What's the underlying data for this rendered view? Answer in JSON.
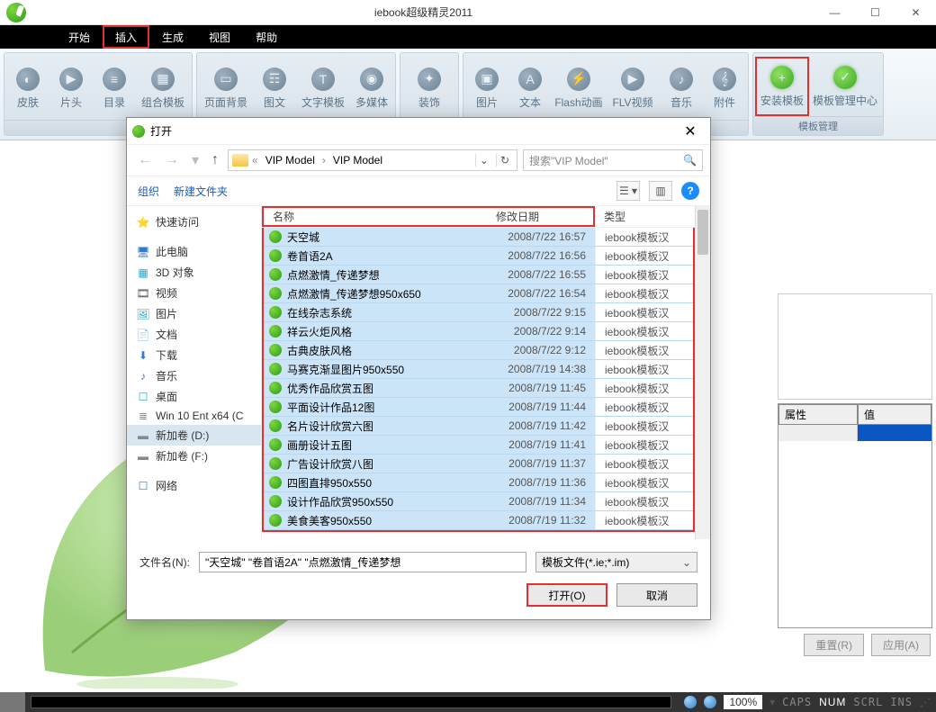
{
  "window": {
    "title": "iebook超级精灵2011",
    "minimize": "—",
    "maximize": "☐",
    "close": "✕"
  },
  "menu": {
    "start": "开始",
    "insert": "插入",
    "generate": "生成",
    "view": "视图",
    "help": "帮助"
  },
  "ribbon": {
    "g1": {
      "skin": "皮肤",
      "title": "片头",
      "toc": "目录",
      "combo": "组合模板"
    },
    "g2": {
      "pagebg": "页面背景",
      "imgtxt": "图文",
      "txttpl": "文字模板",
      "media": "多媒体"
    },
    "g3": {
      "decor": "装饰"
    },
    "g4": {
      "image": "图片",
      "text": "文本",
      "flash": "Flash动画",
      "flv": "FLV视频",
      "music": "音乐",
      "attach": "附件"
    },
    "g5": {
      "install": "安装模板",
      "center": "模板管理中心",
      "label": "模板管理"
    }
  },
  "dialog": {
    "title": "打开",
    "breadcrumb": {
      "root": "VIP Model",
      "sub": "VIP Model"
    },
    "search_placeholder": "搜索\"VIP Model\"",
    "organize": "组织",
    "newfolder": "新建文件夹",
    "cols": {
      "name": "名称",
      "date": "修改日期",
      "type": "类型"
    },
    "filename_label": "文件名(N):",
    "filename_value": "\"天空城\" \"卷首语2A\" \"点燃激情_传递梦想",
    "filter": "模板文件(*.ie;*.im)",
    "open_btn": "打开(O)",
    "cancel_btn": "取消"
  },
  "sidebar": [
    {
      "icon": "⭐",
      "label": "快速访问",
      "color": "#2e7bd6"
    },
    {
      "icon": "🖥",
      "label": "此电脑",
      "color": "#2e7bd6"
    },
    {
      "icon": "▦",
      "label": "3D 对象",
      "color": "#2aa5c9"
    },
    {
      "icon": "🎞",
      "label": "视频",
      "color": "#555"
    },
    {
      "icon": "🖼",
      "label": "图片",
      "color": "#2aa5c9"
    },
    {
      "icon": "📄",
      "label": "文档",
      "color": "#555"
    },
    {
      "icon": "⬇",
      "label": "下载",
      "color": "#2e7bd6"
    },
    {
      "icon": "♪",
      "label": "音乐",
      "color": "#2e7bd6"
    },
    {
      "icon": "☐",
      "label": "桌面",
      "color": "#2aa5c9"
    },
    {
      "icon": "≣",
      "label": "Win 10 Ent x64 (C",
      "color": "#888"
    },
    {
      "icon": "▬",
      "label": "新加卷 (D:)",
      "color": "#888",
      "selected": true
    },
    {
      "icon": "▬",
      "label": "新加卷 (F:)",
      "color": "#888"
    },
    {
      "icon": "☐",
      "label": "网络",
      "color": "#2e7bd6"
    }
  ],
  "files": [
    {
      "name": "天空城",
      "date": "2008/7/22 16:57",
      "type": "iebook模板汉"
    },
    {
      "name": "卷首语2A",
      "date": "2008/7/22 16:56",
      "type": "iebook模板汉"
    },
    {
      "name": "点燃激情_传递梦想",
      "date": "2008/7/22 16:55",
      "type": "iebook模板汉"
    },
    {
      "name": "点燃激情_传递梦想950x650",
      "date": "2008/7/22 16:54",
      "type": "iebook模板汉"
    },
    {
      "name": "在线杂志系统",
      "date": "2008/7/22 9:15",
      "type": "iebook模板汉"
    },
    {
      "name": "祥云火炬风格",
      "date": "2008/7/22 9:14",
      "type": "iebook模板汉"
    },
    {
      "name": "古典皮肤风格",
      "date": "2008/7/22 9:12",
      "type": "iebook模板汉"
    },
    {
      "name": "马赛克渐显图片950x550",
      "date": "2008/7/19 14:38",
      "type": "iebook模板汉"
    },
    {
      "name": "优秀作品欣赏五图",
      "date": "2008/7/19 11:45",
      "type": "iebook模板汉"
    },
    {
      "name": "平面设计作品12图",
      "date": "2008/7/19 11:44",
      "type": "iebook模板汉"
    },
    {
      "name": "名片设计欣赏六图",
      "date": "2008/7/19 11:42",
      "type": "iebook模板汉"
    },
    {
      "name": "画册设计五图",
      "date": "2008/7/19 11:41",
      "type": "iebook模板汉"
    },
    {
      "name": "广告设计欣赏八图",
      "date": "2008/7/19 11:37",
      "type": "iebook模板汉"
    },
    {
      "name": "四图直排950x550",
      "date": "2008/7/19 11:36",
      "type": "iebook模板汉"
    },
    {
      "name": "设计作品欣赏950x550",
      "date": "2008/7/19 11:34",
      "type": "iebook模板汉"
    },
    {
      "name": "美食美客950x550",
      "date": "2008/7/19 11:32",
      "type": "iebook模板汉"
    }
  ],
  "props": {
    "attr": "属性",
    "val": "值",
    "reset": "重置(R)",
    "apply": "应用(A)"
  },
  "status": {
    "zoom": "100%",
    "caps": "CAPS",
    "num": "NUM",
    "scrl": "SCRL",
    "ins": "INS"
  }
}
